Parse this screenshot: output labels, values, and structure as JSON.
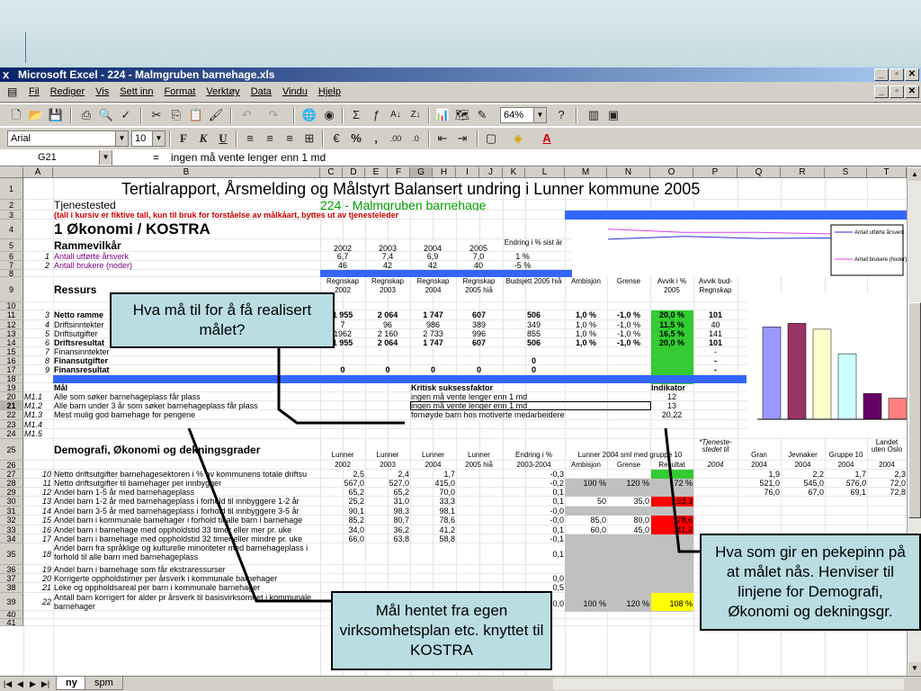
{
  "window": {
    "title": "Microsoft Excel - 224 - Malmgruben barnehage.xls",
    "controls": {
      "minimize": "_",
      "restore": "▫",
      "close": "✕"
    }
  },
  "menu": [
    "Fil",
    "Rediger",
    "Vis",
    "Sett inn",
    "Format",
    "Verktøy",
    "Data",
    "Vindu",
    "Hjelp"
  ],
  "toolbar": {
    "zoom": "64%",
    "font": "Arial",
    "font_size": "10"
  },
  "formula_bar": {
    "cell_ref": "G21",
    "equals": "=",
    "content": "ingen må vente lenger enn 1 md"
  },
  "columns": [
    "A",
    "B",
    "C",
    "D",
    "E",
    "F",
    "G",
    "H",
    "I",
    "J",
    "K",
    "L",
    "M",
    "N",
    "O",
    "P",
    "Q",
    "R",
    "S",
    "T"
  ],
  "sheet": {
    "title": "Tertialrapport, Årsmelding og Målstyrt Balansert undring i Lunner kommune 2005",
    "tjenestested_label": "Tjenestested",
    "tjenestested": "224 - Malmgruben barnehage",
    "note": "(tall i kursiv er fiktive tall, kun til bruk for forståelse av målkåart, byttes ut av tjenesteleder",
    "section1": "1  Økonomi / KOSTRA",
    "rammevilkar": "Rammevilkår",
    "years": [
      "2002",
      "2003",
      "2004",
      "2005"
    ],
    "endring_sist_ar": "Endring i % sist år",
    "r6": {
      "idx": "1",
      "label": "Antall utførte årsverk",
      "values": [
        "6,7",
        "7,4",
        "6,9",
        "7,0"
      ],
      "endring": "1 %"
    },
    "r7": {
      "idx": "2",
      "label": "Antall brukere (noder)",
      "values": [
        "46",
        "42",
        "42",
        "40"
      ],
      "endring": "-5 %"
    },
    "ressurs": "Ressurs",
    "res_headers": [
      "Regnskap 2002",
      "Regnskap 2003",
      "Regnskap 2004",
      "Regnskap 2005 hiå",
      "Budsjett 2005 hiå",
      "Ambisjon",
      "Grense",
      "Avvik i % 2005",
      "Avvik bud-Regnskap"
    ],
    "res_rows": [
      {
        "idx": "3",
        "label": "Netto ramme",
        "values": [
          "1 955",
          "2 064",
          "1 747",
          "607",
          "506",
          "1,0 %",
          "-1,0 %",
          "20,0 %",
          "101"
        ],
        "bold": true
      },
      {
        "idx": "4",
        "label": "Driftsinntekter",
        "values": [
          "7",
          "96",
          "986",
          "389",
          "349",
          "1,0 %",
          "-1,0 %",
          "11,5 %",
          "40"
        ],
        "bold": false
      },
      {
        "idx": "5",
        "label": "Driftsutgifter",
        "values": [
          "1962",
          "2 160",
          "2 733",
          "996",
          "855",
          "1,0 %",
          "-1,0 %",
          "16,5 %",
          "141"
        ],
        "bold": false
      },
      {
        "idx": "6",
        "label": "Driftsresultat",
        "values": [
          "1 955",
          "2 064",
          "1 747",
          "607",
          "506",
          "1,0 %",
          "-1,0 %",
          "20,0 %",
          "101"
        ],
        "bold": true
      },
      {
        "idx": "7",
        "label": "Finansinntekter",
        "values": [
          "",
          "",
          "",
          "",
          "",
          "",
          "",
          "",
          "-"
        ],
        "bold": false
      },
      {
        "idx": "8",
        "label": "Finansutgifter",
        "values": [
          "",
          "",
          "",
          "",
          "0",
          "",
          "",
          "",
          "-"
        ],
        "bold": true
      },
      {
        "idx": "9",
        "label": "Finansresultat",
        "values": [
          "0",
          "0",
          "0",
          "0",
          "0",
          "",
          "",
          "",
          "-"
        ],
        "bold": true
      }
    ],
    "mal_header": "Mål",
    "kritisk_header": "Kritisk suksessfaktor",
    "indikator_header": "Indikator",
    "mal_rows": [
      {
        "idx": "M1.1",
        "mal": "Alle som søker barnehageplass får plass",
        "ksf": "ingen må vente lenger enn 1 md",
        "ind": "12"
      },
      {
        "idx": "M1.2",
        "mal": "Alle barn under 3 år som søker barnehageplass får plass",
        "ksf": "ingen må vente lenger enn 1 md",
        "ind": "13"
      },
      {
        "idx": "M1.3",
        "mal": "Mest mulig god barnehage for pengene",
        "ksf": "fornøyde barn hos motiverte medarbeidere",
        "ind": "20,22"
      },
      {
        "idx": "M1.4",
        "mal": "",
        "ksf": "",
        "ind": ""
      },
      {
        "idx": "M1.5",
        "mal": "",
        "ksf": "",
        "ind": ""
      }
    ],
    "demografi": "Demografi, Økonomi og dekningsgrader",
    "demo_headers": [
      "Lunner",
      "Lunner",
      "Lunner",
      "Lunner",
      "Endring i %",
      "Lunner 2004 sml med gruppe 10",
      "",
      "",
      "*Tjeneste-stedet til",
      "Gran",
      "Jevnaker",
      "Gruppe 10",
      "Landet uten Oslo"
    ],
    "demo_sub": [
      "2002",
      "2003",
      "2004",
      "2005 hiå",
      "2003-2004",
      "Ambisjon",
      "Grense",
      "Resultat",
      "2004",
      "2004",
      "2004",
      "2004",
      "2004"
    ],
    "demo_rows": [
      {
        "idx": "10",
        "label": "Netto driftsutgifter barnehagesektoren i % av kommunens totale driftsu",
        "v": [
          "2,5",
          "2,4",
          "1,7",
          "",
          "-0,3",
          "",
          "",
          "",
          "",
          "1,9",
          "2,2",
          "1,7",
          "2,3"
        ]
      },
      {
        "idx": "11",
        "label": "Netto driftsutgifter til barnehager per innbygger",
        "v": [
          "567,0",
          "527,0",
          "415,0",
          "",
          "-0,2",
          "100 %",
          "120 %",
          "72 %",
          "",
          "521,0",
          "545,0",
          "576,0",
          "72,0"
        ]
      },
      {
        "idx": "12",
        "label": "Andel barn 1-5 år med barnehageplass",
        "v": [
          "65,2",
          "65,2",
          "70,0",
          "",
          "0,1",
          "",
          "",
          "",
          "",
          "76,0",
          "67,0",
          "69,1",
          "72,8"
        ]
      },
      {
        "idx": "13",
        "label": "Andel barn 1-2 år med barnehageplass i forhold til innbyggere 1-2 år",
        "v": [
          "25,2",
          "31,0",
          "33,3",
          "",
          "0,1",
          "50",
          "35,0",
          "33,3",
          "",
          "",
          "",
          "",
          ""
        ]
      },
      {
        "idx": "14",
        "label": "Andel barn 3-5 år med barnehageplass i forhold til innbyggere 3-5 år",
        "v": [
          "90,1",
          "98,3",
          "98,1",
          "",
          "-0,0",
          "",
          "",
          "",
          "",
          "",
          "",
          "",
          ""
        ]
      },
      {
        "idx": "15",
        "label": "Andel barn i kommunale barnehager i forhold til alle barn i barnehage",
        "v": [
          "85,2",
          "80,7",
          "78,6",
          "",
          "-0,0",
          "85,0",
          "80,0",
          "78,6",
          "",
          "",
          "",
          "",
          ""
        ]
      },
      {
        "idx": "16",
        "label": "Andel barn i barnehage med oppholdstid 33 timer eller mer pr. uke",
        "v": [
          "34,0",
          "36,2",
          "41,2",
          "",
          "0,1",
          "60,0",
          "45,0",
          "41,2",
          "",
          "",
          "",
          "",
          ""
        ]
      },
      {
        "idx": "17",
        "label": "Andel barn i barnehage med oppholdstid 32 timer eller mindre pr. uke",
        "v": [
          "66,0",
          "63,8",
          "58,8",
          "",
          "-0,1",
          "",
          "",
          "",
          "",
          "",
          "",
          "",
          ""
        ]
      },
      {
        "idx": "18",
        "label": "Andel barn fra språklige og kulturelle minoriteter med barnehageplass i forhold til alle barn med barnehageplass",
        "v": [
          "",
          "",
          "",
          "",
          "0,1",
          "",
          "",
          "",
          "",
          "",
          "",
          "",
          ""
        ]
      },
      {
        "idx": "19",
        "label": "Andel barn i barnehage som får ekstraressurser",
        "v": [
          "",
          "",
          "",
          "",
          "",
          "",
          "",
          "",
          "",
          "",
          "",
          "",
          ""
        ]
      },
      {
        "idx": "20",
        "label": "Korrigerte oppholdstimer per årsverk i kommunale barnehager",
        "v": [
          "",
          "",
          "",
          "",
          "0,0",
          "",
          "",
          "",
          "",
          "",
          "",
          "",
          ""
        ]
      },
      {
        "idx": "21",
        "label": "Leke og oppholdsareal per barn i kommunale barnehager",
        "v": [
          "",
          "",
          "",
          "",
          "0,5",
          "",
          "",
          "",
          "",
          "",
          "",
          "",
          ""
        ]
      },
      {
        "idx": "22",
        "label": "Antall barn korrigert for alder pr årsverk til basisvirksomhet i kommunale barnehager",
        "v": [
          "",
          "",
          "",
          "",
          "0,0",
          "100 %",
          "120 %",
          "108 %",
          "",
          "",
          "",
          "",
          ""
        ]
      }
    ],
    "legend": [
      "Antall utførte årsverk",
      "Antall brukere (hoder)"
    ]
  },
  "line_chart": {
    "series": [
      {
        "name": "Antall utførte årsverk",
        "values": [
          6.7,
          7.4,
          6.9,
          7.0
        ],
        "color": "#2b2bd8"
      },
      {
        "name": "Antall brukere (hoder)",
        "values": [
          46,
          42,
          42,
          40
        ],
        "color": "#e040e0"
      }
    ]
  },
  "bar_chart": {
    "values": [
      79,
      82,
      77,
      56,
      22,
      18
    ],
    "colors": [
      "#9999ff",
      "#993366",
      "#ffffcc",
      "#ccffff",
      "#660066",
      "#ff8080"
    ]
  },
  "callouts": {
    "c1": "Hva må til for å få realisert målet?",
    "c2": "Mål hentet fra egen virksomhetsplan etc. knyttet til KOSTRA",
    "c3": "Hva som gir en pekepinn på at målet nås. Henviser til linjene for Demografi, Økonomi og dekningsgr."
  },
  "tabs": [
    "ny",
    "spm"
  ]
}
